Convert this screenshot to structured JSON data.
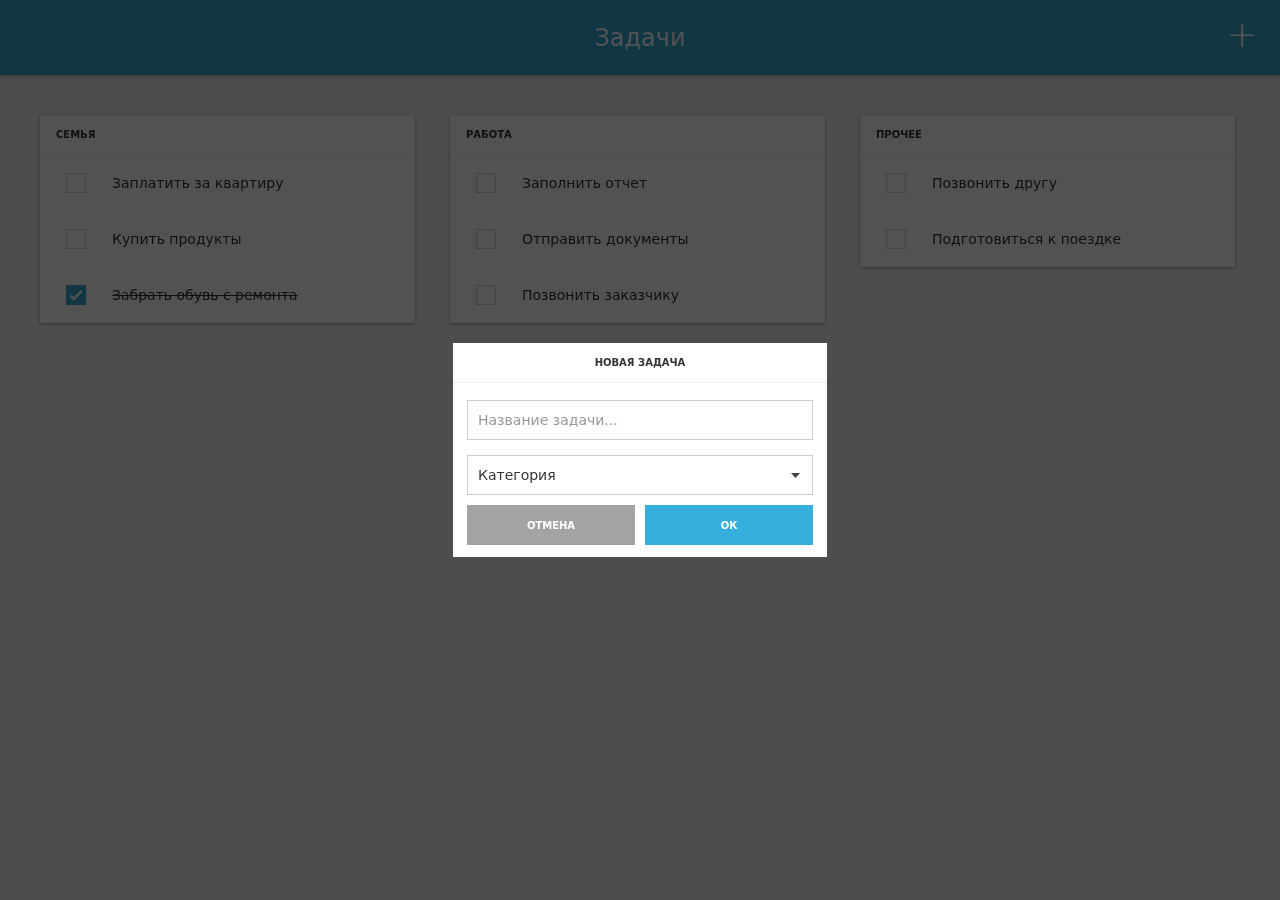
{
  "header": {
    "title": "Задачи",
    "add_icon": "+"
  },
  "categories": [
    {
      "title": "СЕМЬЯ",
      "tasks": [
        {
          "label": "Заплатить за квартиру",
          "checked": false
        },
        {
          "label": "Купить продукты",
          "checked": false
        },
        {
          "label": "Забрать обувь с ремонта",
          "checked": true
        }
      ]
    },
    {
      "title": "РАБОТА",
      "tasks": [
        {
          "label": "Заполнить отчет",
          "checked": false
        },
        {
          "label": "Отправить документы",
          "checked": false
        },
        {
          "label": "Позвонить заказчику",
          "checked": false
        }
      ]
    },
    {
      "title": "ПРОЧЕЕ",
      "tasks": [
        {
          "label": "Позвонить другу",
          "checked": false
        },
        {
          "label": "Подготовиться к поездке",
          "checked": false
        }
      ]
    }
  ],
  "dialog": {
    "title": "НОВАЯ ЗАДАЧА",
    "name_field": {
      "placeholder": "Название задачи..."
    },
    "category_select": {
      "value": "Категория"
    },
    "buttons": [
      {
        "label": "ОТМЕНА",
        "kind": "cancel"
      },
      {
        "label": "ОК",
        "kind": "ok"
      }
    ]
  }
}
